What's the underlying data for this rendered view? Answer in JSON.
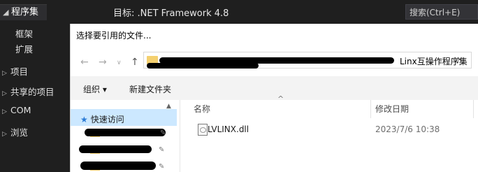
{
  "vs": {
    "app_title": "程序集",
    "target": "目标: .NET Framework 4.8",
    "search_placeholder": "搜索(Ctrl+E)",
    "nav": {
      "framework": "框架",
      "extensions": "扩展",
      "projects": "项目",
      "shared_projects": "共享的项目",
      "com": "COM",
      "browse": "浏览"
    }
  },
  "dialog": {
    "title": "选择要引用的文件...",
    "address_tail": "Linx互操作程序集",
    "toolbar": {
      "organize": "组织 ▾",
      "new_folder": "新建文件夹"
    },
    "nav_pane": {
      "quick_access": "快速访问"
    },
    "columns": {
      "name": "名称",
      "date_modified": "修改日期"
    },
    "files": [
      {
        "name": "LVLINX.dll",
        "date": "2023/7/6 10:38"
      }
    ]
  }
}
